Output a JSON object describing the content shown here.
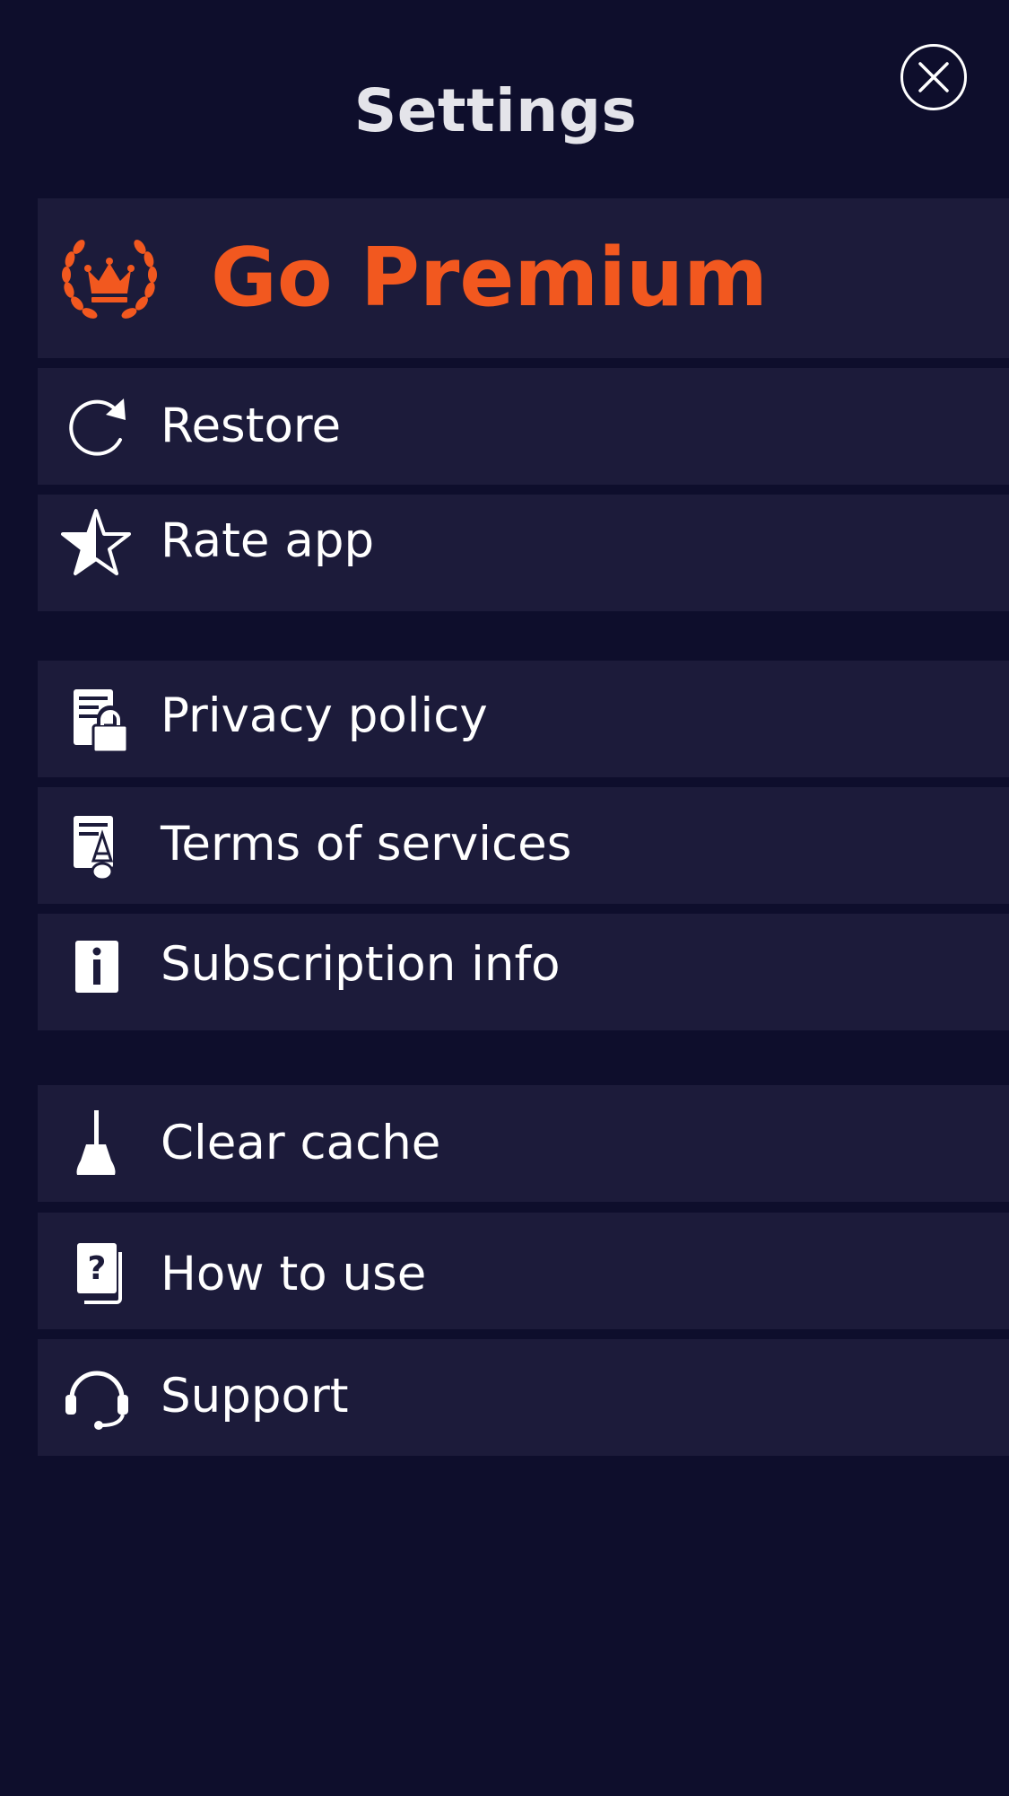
{
  "header": {
    "title": "Settings",
    "close_icon": "close-circle-icon"
  },
  "premium": {
    "label": "Go Premium",
    "icon": "crown-laurel-icon",
    "accent_color": "#f2581f"
  },
  "items": [
    {
      "label": "Restore",
      "icon": "refresh-icon"
    },
    {
      "label": "Rate app",
      "icon": "star-icon"
    },
    {
      "label": "Privacy policy",
      "icon": "document-lock-icon"
    },
    {
      "label": "Terms of services",
      "icon": "document-sign-icon"
    },
    {
      "label": "Subscription info",
      "icon": "info-icon"
    },
    {
      "label": "Clear cache",
      "icon": "broom-icon"
    },
    {
      "label": "How to use",
      "icon": "help-cards-icon"
    },
    {
      "label": "Support",
      "icon": "headset-icon"
    }
  ],
  "colors": {
    "background": "#0e0e2c",
    "row_background": "#1c1b3a",
    "text": "#ffffff"
  }
}
